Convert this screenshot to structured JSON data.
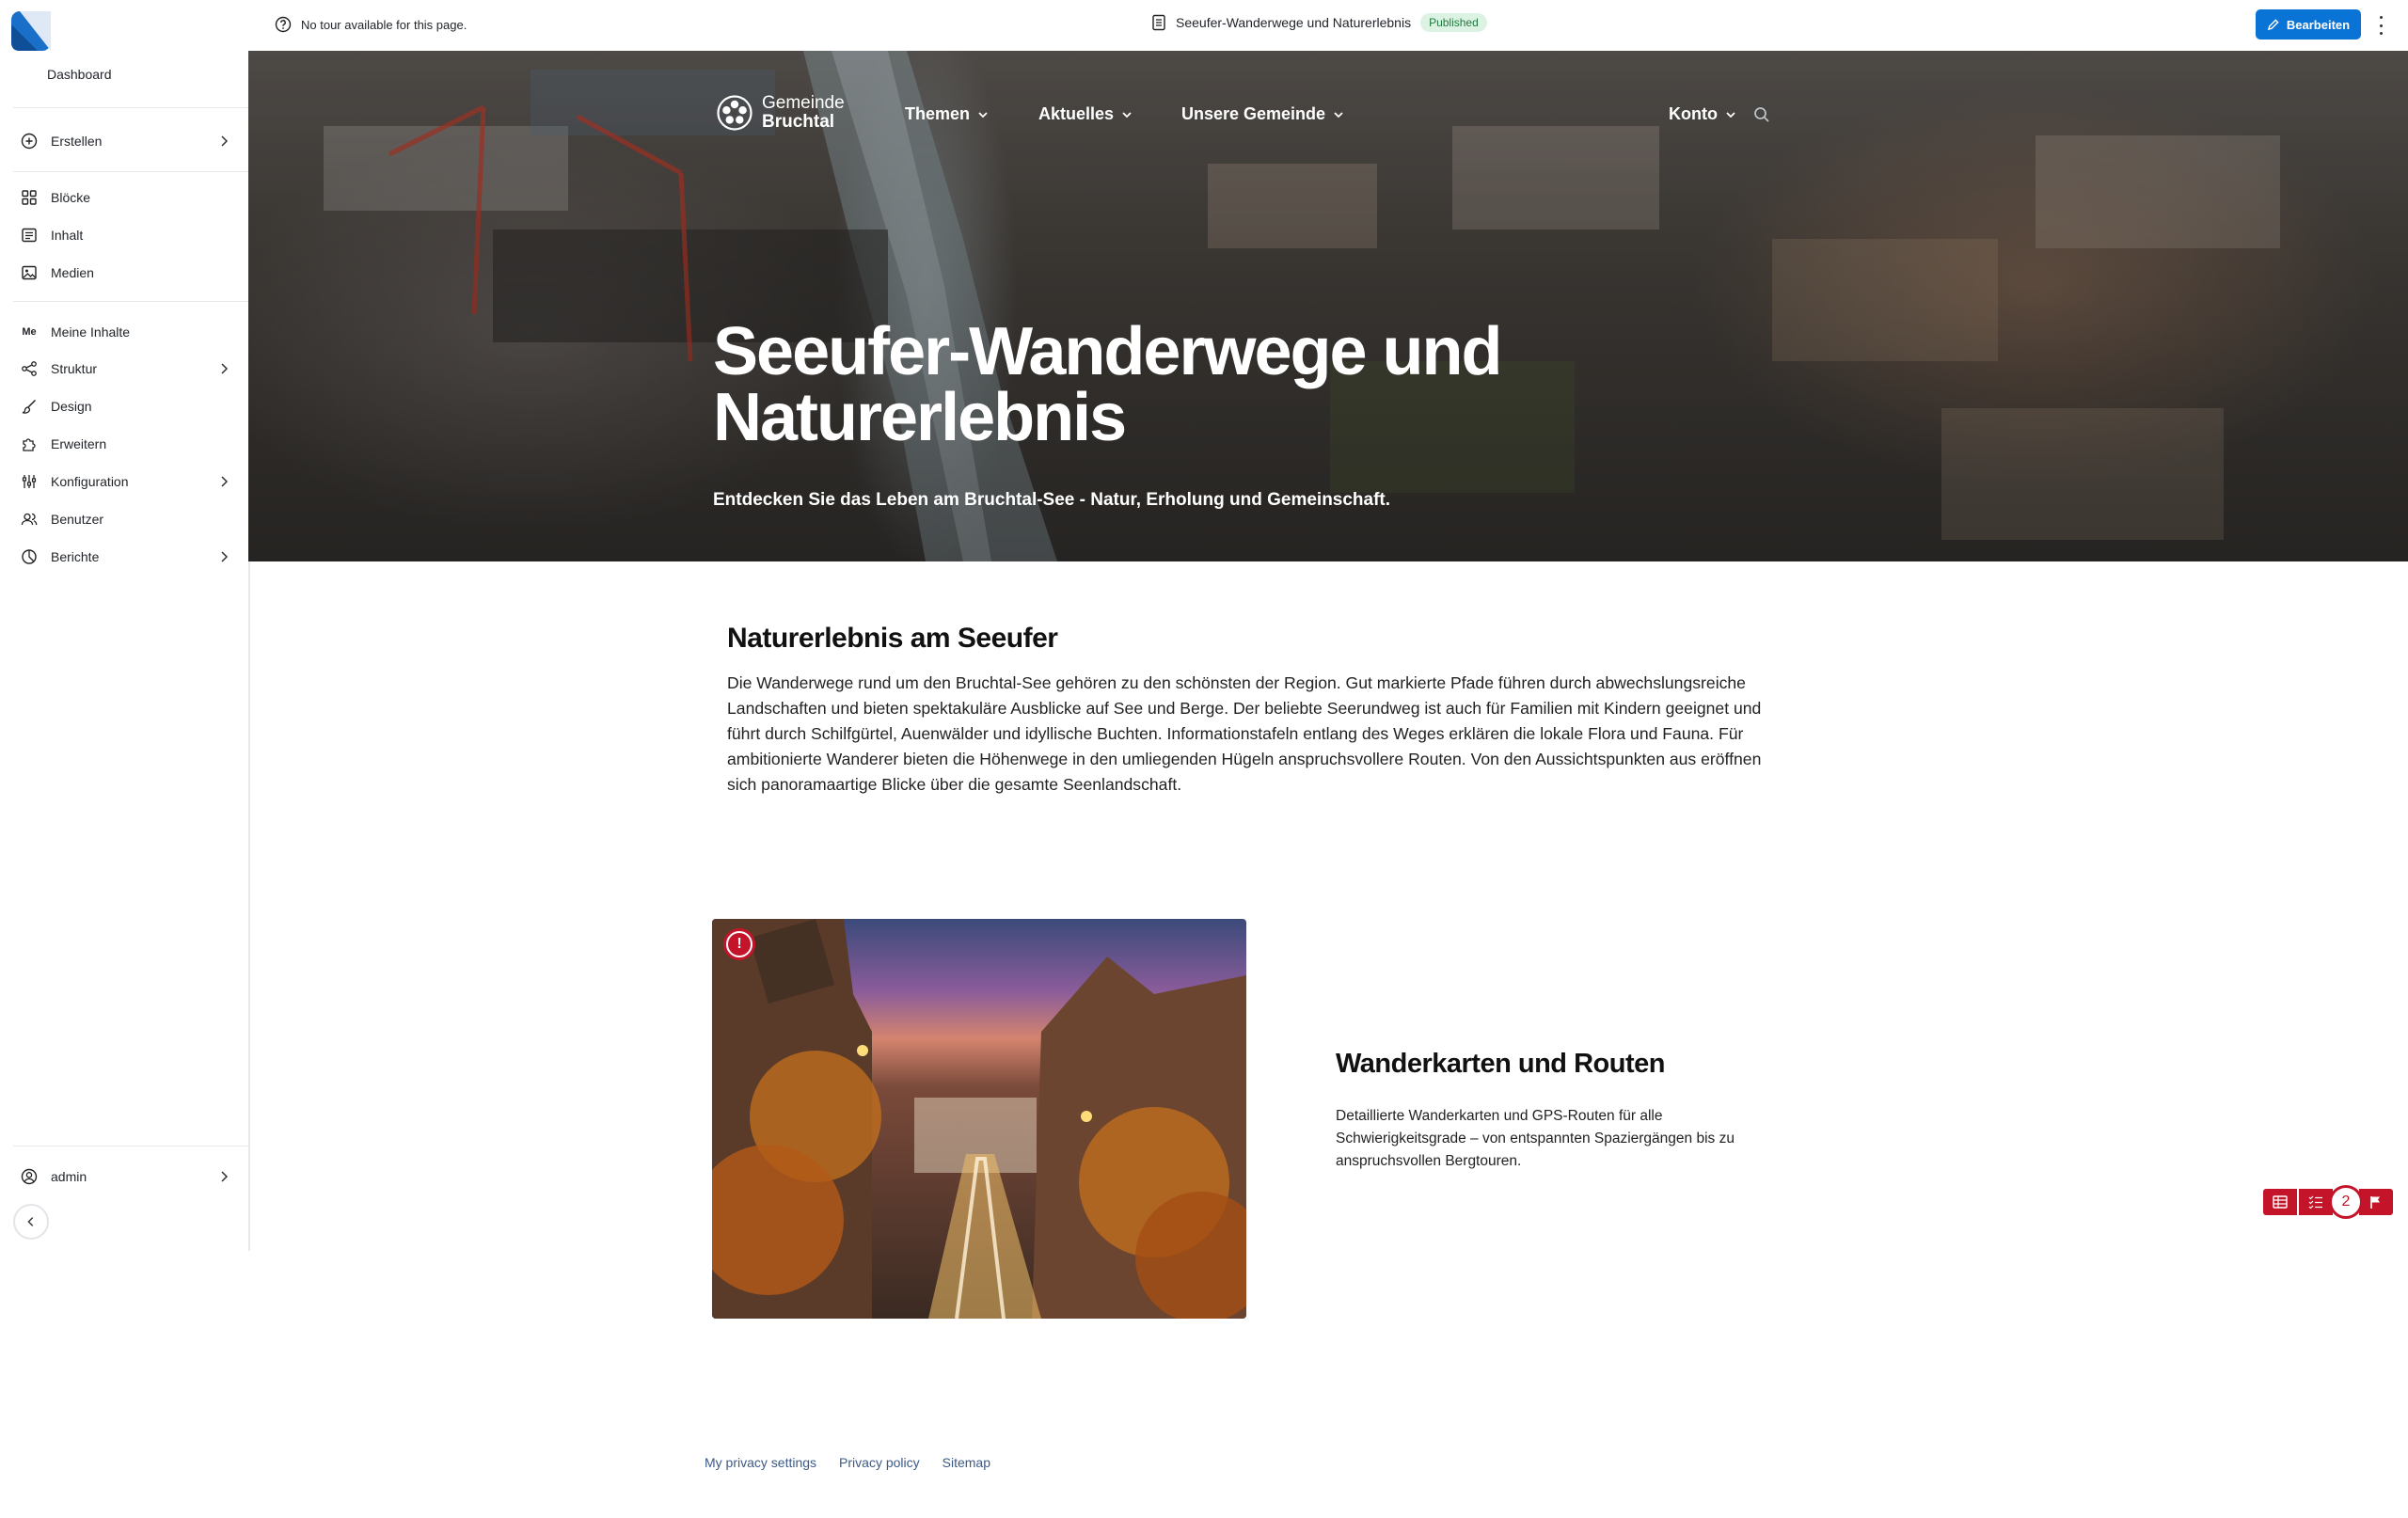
{
  "sidebar": {
    "dashboard_label": "Dashboard",
    "items": [
      {
        "label": "Erstellen",
        "icon": "plus-circle-icon",
        "has_submenu": true
      },
      {
        "label": "Blöcke",
        "icon": "blocks-grid-icon",
        "has_submenu": false
      },
      {
        "label": "Inhalt",
        "icon": "content-list-icon",
        "has_submenu": false
      },
      {
        "label": "Medien",
        "icon": "media-image-icon",
        "has_submenu": false
      },
      {
        "label": "Meine Inhalte",
        "icon": "me-badge-icon",
        "badge": "Me",
        "has_submenu": false
      },
      {
        "label": "Struktur",
        "icon": "structure-icon",
        "has_submenu": true
      },
      {
        "label": "Design",
        "icon": "brush-icon",
        "has_submenu": false
      },
      {
        "label": "Erweitern",
        "icon": "puzzle-icon",
        "has_submenu": false
      },
      {
        "label": "Konfiguration",
        "icon": "sliders-icon",
        "has_submenu": true
      },
      {
        "label": "Benutzer",
        "icon": "users-icon",
        "has_submenu": false
      },
      {
        "label": "Berichte",
        "icon": "reports-pie-icon",
        "has_submenu": true
      }
    ],
    "user": {
      "label": "admin",
      "icon": "user-circle-icon"
    }
  },
  "topbar": {
    "tour_text": "No tour available for this page.",
    "page_title": "Seeufer-Wanderwege und Naturerlebnis",
    "status": "Published",
    "edit_label": "Bearbeiten"
  },
  "hero": {
    "brand_line1": "Gemeinde",
    "brand_line2": "Bruchtal",
    "nav": [
      "Themen",
      "Aktuelles",
      "Unsere Gemeinde"
    ],
    "account_label": "Konto",
    "title": "Seeufer-Wanderwege und Naturerlebnis",
    "subtitle": "Entdecken Sie das Leben am Bruchtal-See - Natur, Erholung und Gemeinschaft."
  },
  "section": {
    "title": "Naturerlebnis am Seeufer",
    "text": "Die Wanderwege rund um den Bruchtal-See gehören zu den schönsten der Region. Gut markierte Pfade führen durch abwechslungsreiche Landschaften und bieten spektakuläre Ausblicke auf See und Berge. Der beliebte Seerundweg ist auch für Familien mit Kindern geeignet und führt durch Schilfgürtel, Auenwälder und idyllische Buchten. Informationstafeln entlang des Weges erklären die lokale Flora und Fauna. Für ambitionierte Wanderer bieten die Höhenwege in den umliegenden Hügeln anspruchsvollere Routen. Von den Aussichtspunkten aus eröffnen sich panoramaartige Blicke über die gesamte Seenlandschaft."
  },
  "card": {
    "title": "Wanderkarten und Routen",
    "text": "Detaillierte Wanderkarten und GPS-Routen für alle Schwierigkeitsgrade – von entspannten Spaziergängen bis zu anspruchsvollen Bergtouren.",
    "warning_glyph": "!"
  },
  "float_toolbar": {
    "count": "2"
  },
  "footer": {
    "links": [
      "My privacy settings",
      "Privacy policy",
      "Sitemap"
    ]
  },
  "colors": {
    "accent": "#0a74d6",
    "alert": "#c3142a",
    "published_bg": "#dcf3e4",
    "published_fg": "#1e7a3d"
  }
}
